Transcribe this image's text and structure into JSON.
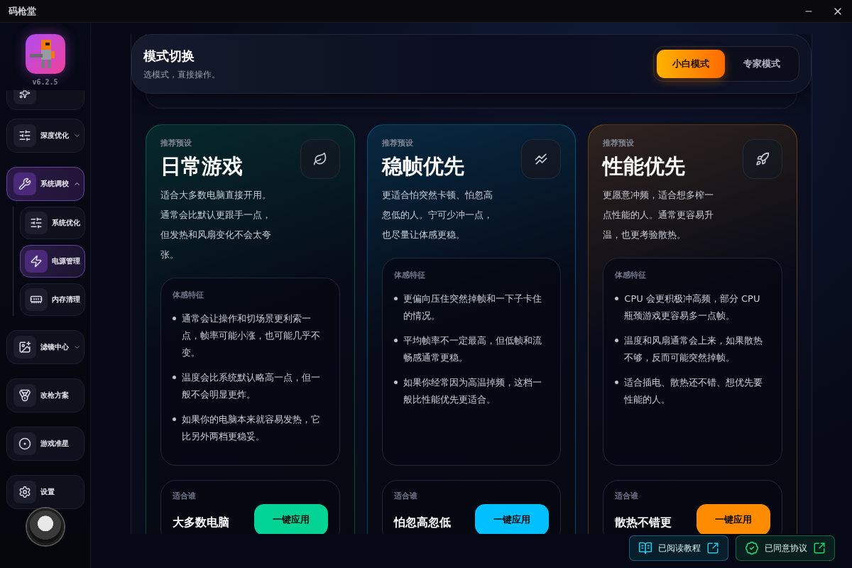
{
  "window": {
    "title": "码枪堂"
  },
  "sidebar": {
    "version": "v6.2.5",
    "items": [
      {
        "label": "深度优化",
        "expanded": false
      },
      {
        "label": "系统调校",
        "expanded": true,
        "children": [
          {
            "label": "系统优化",
            "selected": false
          },
          {
            "label": "电源管理",
            "selected": true
          },
          {
            "label": "内存清理",
            "selected": false
          }
        ]
      },
      {
        "label": "滤镜中心",
        "expanded": false
      },
      {
        "label": "改枪方案",
        "selected": false
      },
      {
        "label": "游戏准星",
        "selected": false
      },
      {
        "label": "设置",
        "selected": false
      }
    ]
  },
  "header": {
    "title": "模式切换",
    "subtitle": "选模式，直接操作。",
    "modes": [
      {
        "label": "小白模式",
        "selected": true
      },
      {
        "label": "专家模式",
        "selected": false
      }
    ]
  },
  "presets": [
    {
      "tag": "推荐预设",
      "title": "日常游戏",
      "color": "#00d394",
      "description": "适合大多数电脑直接开用。通常会比默认更跟手一点，但发热和风扇变化不会太夸张。",
      "features_label": "体感特征",
      "features": [
        "通常会让操作和切场景更利索一点，帧率可能小涨，也可能几乎不变。",
        "温度会比系统默认略高一点，但一般不会明显更炸。",
        "如果你的电脑本来就容易发热，它比另外两档更稳妥。"
      ],
      "fit_label": "适合谁",
      "fit": "大多数电脑",
      "apply": "一键应用"
    },
    {
      "tag": "推荐预设",
      "title": "稳帧优先",
      "color": "#00c0ff",
      "description": "更适合怕突然卡顿、怕忽高忽低的人。宁可少冲一点，也尽量让体感更稳。",
      "features_label": "体感特征",
      "features": [
        "更偏向压住突然掉帧和一下子卡住的情况。",
        "平均帧率不一定最高，但低帧和流畅感通常更稳。",
        "如果你经常因为高温掉频，这档一般比性能优先更适合。"
      ],
      "fit_label": "适合谁",
      "fit": "怕忽高忽低",
      "apply": "一键应用"
    },
    {
      "tag": "推荐预设",
      "title": "性能优先",
      "color": "#ff8c00",
      "description": "更愿意冲频，适合想多榨一点性能的人。通常更容易升温，也更考验散热。",
      "features_label": "体感特征",
      "features": [
        "CPU 会更积极冲高频，部分 CPU 瓶颈游戏更容易多一点帧。",
        "温度和风扇通常会上来，如果散热不够，反而可能突然掉帧。",
        "适合插电、散热还不错、想优先要性能的人。"
      ],
      "fit_label": "适合谁",
      "fit": "散热不错更",
      "apply": "一键应用"
    }
  ],
  "footer_links": [
    {
      "label": "已阅读教程",
      "color": "#27c6e6"
    },
    {
      "label": "已同意协议",
      "color": "#22d36b"
    }
  ]
}
